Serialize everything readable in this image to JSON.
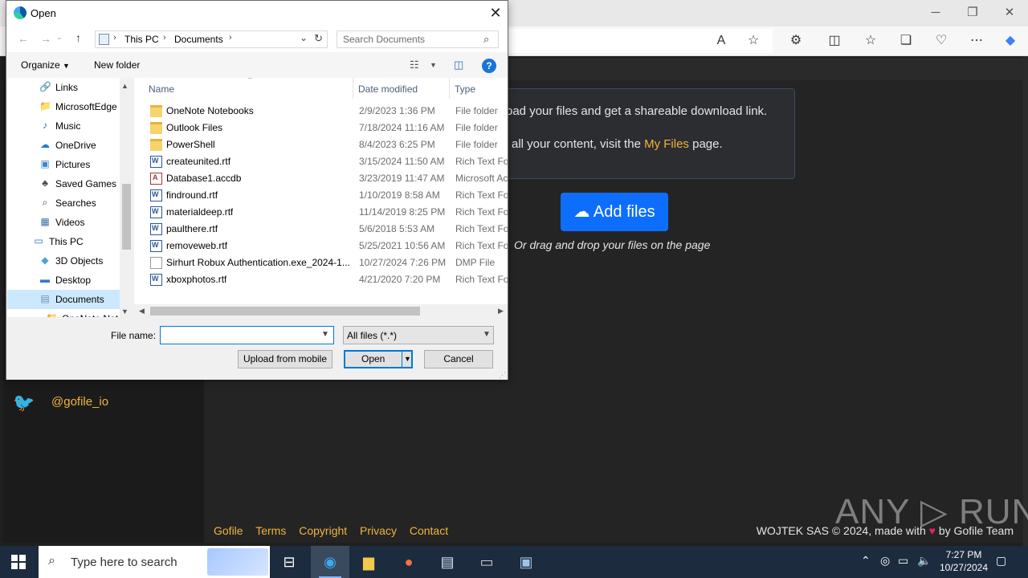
{
  "dialog": {
    "title": "Open",
    "close_glyph": "✕",
    "breadcrumb": [
      "This PC",
      "Documents"
    ],
    "search_placeholder": "Search Documents",
    "organize_label": "Organize",
    "new_folder_label": "New folder",
    "nav_tree": [
      {
        "label": "Links",
        "icon": "links-icon",
        "glyph": "🔗",
        "indent": 2
      },
      {
        "label": "MicrosoftEdge",
        "icon": "folder-icon",
        "glyph": "📁",
        "indent": 2
      },
      {
        "label": "Music",
        "icon": "music-icon",
        "glyph": "♪",
        "indent": 2
      },
      {
        "label": "OneDrive",
        "icon": "onedrive-icon",
        "glyph": "☁",
        "indent": 2
      },
      {
        "label": "Pictures",
        "icon": "pictures-icon",
        "glyph": "▣",
        "indent": 2
      },
      {
        "label": "Saved Games",
        "icon": "saved-games-icon",
        "glyph": "♣",
        "indent": 2
      },
      {
        "label": "Searches",
        "icon": "search-icon",
        "glyph": "⌕",
        "indent": 2
      },
      {
        "label": "Videos",
        "icon": "videos-icon",
        "glyph": "▦",
        "indent": 2
      },
      {
        "label": "This PC",
        "icon": "computer-icon",
        "glyph": "▭",
        "indent": 1
      },
      {
        "label": "3D Objects",
        "icon": "3d-objects-icon",
        "glyph": "◆",
        "indent": 2
      },
      {
        "label": "Desktop",
        "icon": "desktop-icon",
        "glyph": "▬",
        "indent": 2
      },
      {
        "label": "Documents",
        "icon": "documents-icon",
        "glyph": "▤",
        "indent": 2,
        "selected": true
      },
      {
        "label": "OneNote Not",
        "icon": "folder-icon",
        "glyph": "📁",
        "indent": 3
      }
    ],
    "columns": {
      "name": "Name",
      "date": "Date modified",
      "type": "Type"
    },
    "files": [
      {
        "name": "OneNote Notebooks",
        "date": "2/9/2023 1:36 PM",
        "type": "File folder",
        "kind": "folder"
      },
      {
        "name": "Outlook Files",
        "date": "7/18/2024 11:16 AM",
        "type": "File folder",
        "kind": "folder"
      },
      {
        "name": "PowerShell",
        "date": "8/4/2023 6:25 PM",
        "type": "File folder",
        "kind": "folder"
      },
      {
        "name": "createunited.rtf",
        "date": "3/15/2024 11:50 AM",
        "type": "Rich Text For",
        "kind": "rtf"
      },
      {
        "name": "Database1.accdb",
        "date": "3/23/2019 11:47 AM",
        "type": "Microsoft Ac",
        "kind": "accdb"
      },
      {
        "name": "findround.rtf",
        "date": "1/10/2019 8:58 AM",
        "type": "Rich Text For",
        "kind": "rtf"
      },
      {
        "name": "materialdeep.rtf",
        "date": "11/14/2019 8:25 PM",
        "type": "Rich Text For",
        "kind": "rtf"
      },
      {
        "name": "paulthere.rtf",
        "date": "5/6/2018 5:53 AM",
        "type": "Rich Text For",
        "kind": "rtf"
      },
      {
        "name": "removeweb.rtf",
        "date": "5/25/2021 10:56 AM",
        "type": "Rich Text For",
        "kind": "rtf"
      },
      {
        "name": "Sirhurt Robux Authentication.exe_2024-1...",
        "date": "10/27/2024 7:26 PM",
        "type": "DMP File",
        "kind": "file"
      },
      {
        "name": "xboxphotos.rtf",
        "date": "4/21/2020 7:20 PM",
        "type": "Rich Text For",
        "kind": "rtf"
      }
    ],
    "file_name_label": "File name:",
    "file_name_value": "",
    "file_type_value": "All files (*.*)",
    "upload_mobile_label": "Upload from mobile",
    "open_label": "Open",
    "cancel_label": "Cancel"
  },
  "page": {
    "info_line1": "oad your files and get a shareable download link.",
    "info_line2_prefix": "all your content, visit the",
    "info_line2_link": "My Files",
    "info_line2_suffix": "page.",
    "add_files_label": "Add files",
    "drag_text": "Or drag and drop your files on the page",
    "twitter_handle": "@gofile_io",
    "footer_links": [
      "Gofile",
      "Terms",
      "Copyright",
      "Privacy",
      "Contact"
    ],
    "footer_right_prefix": "WOJTEK SAS © 2024, made with",
    "footer_right_suffix": "by Gofile Team",
    "watermark": "ANY ▷ RUN"
  },
  "taskbar": {
    "search_placeholder": "Type here to search",
    "time": "7:27 PM",
    "date": "10/27/2024"
  },
  "colors": {
    "accent": "#0078d7",
    "link": "#f2b53a",
    "add_button": "#0d6efd"
  }
}
